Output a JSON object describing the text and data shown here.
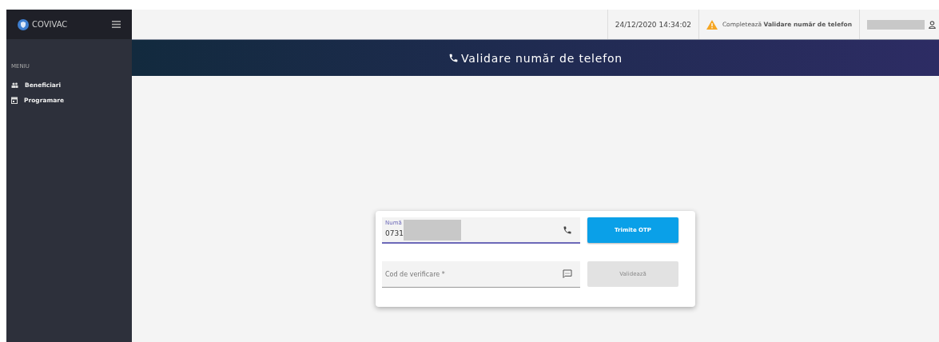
{
  "sidebar": {
    "brand": "COVIVAC",
    "section": "MENIU",
    "items": [
      {
        "label": "Beneficiari"
      },
      {
        "label": "Programare"
      }
    ]
  },
  "topbar": {
    "datetime": "24/12/2020 14:34:02",
    "notice": "Completează **Validare număr de telefon**"
  },
  "banner": {
    "title": "Validare număr de telefon"
  },
  "form": {
    "fields": [
      {
        "label": "Numă",
        "value": "0731",
        "focused": true
      },
      {
        "placeholder": "Cod de verificare *",
        "focused": false
      }
    ],
    "buttons": [
      {
        "label": "Trimite OTP",
        "disabled": false
      },
      {
        "label": "Validează",
        "disabled": true
      }
    ]
  }
}
